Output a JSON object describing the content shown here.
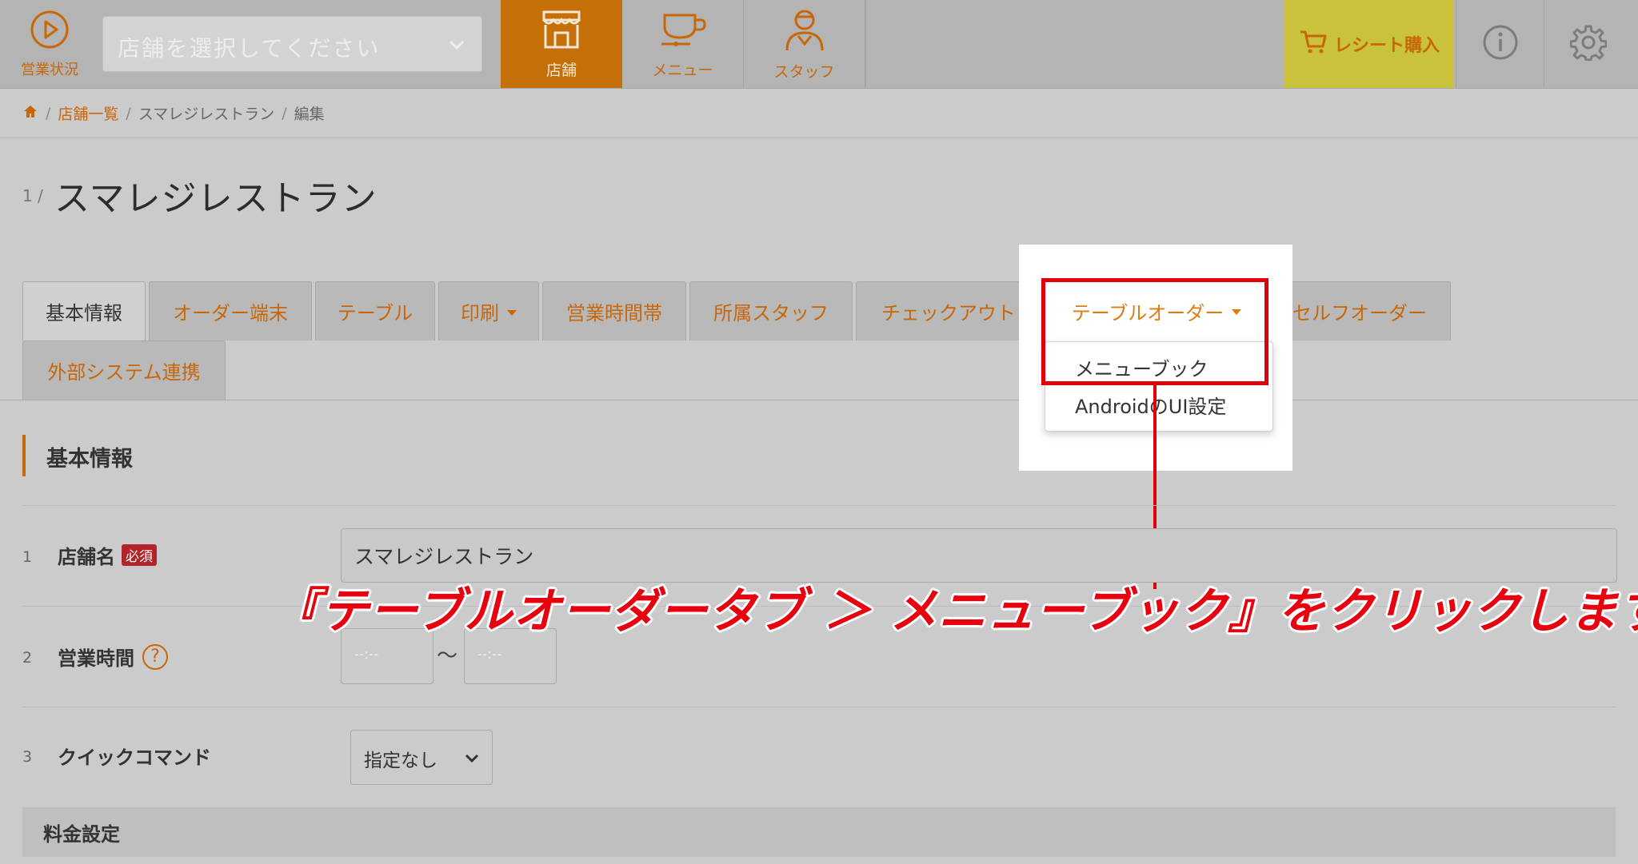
{
  "topbar": {
    "status_label": "営業状況",
    "store_select_placeholder": "店舗を選択してください",
    "nav": [
      {
        "label": "店舗",
        "icon": "store-icon",
        "active": true
      },
      {
        "label": "メニュー",
        "icon": "menu-cup-icon",
        "active": false
      },
      {
        "label": "スタッフ",
        "icon": "staff-icon",
        "active": false
      }
    ],
    "receipt_label": "レシート購入",
    "accent_color": "#c8670a",
    "receipt_bg": "#c9c23a"
  },
  "breadcrumb": {
    "home_icon": "home-icon",
    "items": [
      "店舗一覧",
      "スマレジレストラン",
      "編集"
    ]
  },
  "page": {
    "number": "1 /",
    "title": "スマレジレストラン"
  },
  "tabs": [
    {
      "label": "基本情報",
      "active": true
    },
    {
      "label": "オーダー端末"
    },
    {
      "label": "テーブル"
    },
    {
      "label": "印刷",
      "dropdown": true
    },
    {
      "label": "営業時間帯"
    },
    {
      "label": "所属スタッフ"
    },
    {
      "label": "チェックアウト"
    },
    {
      "label": "テーブルオーダー",
      "dropdown": true
    },
    {
      "label": "セルフオーダー"
    },
    {
      "label": "外部システム連携"
    }
  ],
  "dropdown": {
    "items": [
      "メニューブック",
      "AndroidのUI設定"
    ]
  },
  "annotation": {
    "instruction": "『テーブルオーダータブ ＞ メニューブック』をクリックします。",
    "color": "#e0000b"
  },
  "section": {
    "title": "基本情報",
    "rows": [
      {
        "num": "1",
        "label": "店舗名",
        "badge": "必須",
        "value": "スマレジレストラン"
      },
      {
        "num": "2",
        "label": "営業時間",
        "help": "?",
        "start_placeholder": "--:--",
        "tilde": "〜",
        "end_placeholder": "--:--"
      },
      {
        "num": "3",
        "label": "クイックコマンド",
        "value": "指定なし"
      }
    ]
  },
  "fee": {
    "title": "料金設定"
  }
}
